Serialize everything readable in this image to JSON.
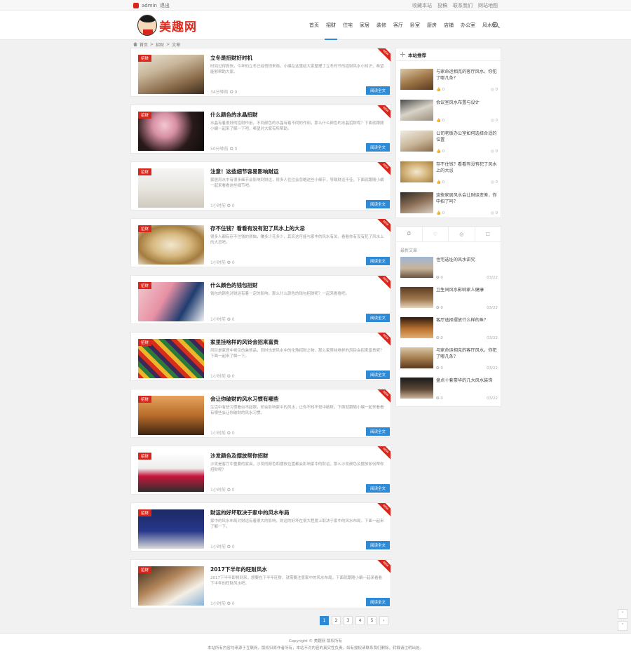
{
  "topbar": {
    "user": "admin",
    "exit": "退出",
    "right_links": [
      "收藏本站",
      "投稿",
      "联系我们",
      "网站地图"
    ]
  },
  "logo": {
    "text": "美趣网"
  },
  "nav": {
    "items": [
      "首页",
      "招财",
      "住宅",
      "家居",
      "装修",
      "客厅",
      "卧室",
      "厨房",
      "店铺",
      "办公室",
      "风水鱼"
    ],
    "active": 1
  },
  "breadcrumb": {
    "home": "首页",
    "sep": ">",
    "cat": "招财",
    "current": "文章"
  },
  "posts": [
    {
      "cat": "招财",
      "title": "立冬是招财好时机",
      "excerpt": "时间过得真快，今年的立冬已经悄悄来临，小编在这里给大家整理了立冬时节的招财风水小知识，希望能够帮助大家。",
      "time": "34分钟前",
      "comments": "0",
      "more": "阅读全文",
      "new": "NEW"
    },
    {
      "cat": "招财",
      "title": "什么颜色的水晶招财",
      "excerpt": "水晶有着很好的招财作用，不同颜色的水晶有着不同的作用，那么什么颜色的水晶招财呢？下面就跟随小编一起来了解一下吧，希望对大家有所帮助。",
      "time": "50分钟前",
      "comments": "0",
      "more": "阅读全文",
      "new": "NEW"
    },
    {
      "cat": "招财",
      "title": "注意！这些细节容易影响财运",
      "excerpt": "家居风水中有很多细节会影响到财运，很多人往往会忽略这些小细节，导致财运不佳，下面就跟随小编一起来看看这些细节吧。",
      "time": "1小时前",
      "comments": "0",
      "more": "阅读全文",
      "new": "NEW"
    },
    {
      "cat": "招财",
      "title": "存不住钱？看看有没有犯了风水上的大忌",
      "excerpt": "很多人都有存不住钱的烦恼，赚多少花多少，其实这可能与家中的风水有关，看看你有没有犯了风水上的大忌吧。",
      "time": "1小时前",
      "comments": "0",
      "more": "阅读全文",
      "new": "NEW"
    },
    {
      "cat": "招财",
      "title": "什么颜色的钱包招财",
      "excerpt": "钱包的颜色对财运有着一定的影响，那么什么颜色的钱包招财呢？一起来看看吧。",
      "time": "1小时前",
      "comments": "0",
      "more": "阅读全文",
      "new": "NEW"
    },
    {
      "cat": "招财",
      "title": "家里挂啥样的风铃会招来富贵",
      "excerpt": "风铃是家居中常见的装饰品，同时也是风水中的化煞招财之物，那么家里挂啥样的风铃会招来富贵呢？下面一起来了解一下。",
      "time": "1小时前",
      "comments": "0",
      "more": "阅读全文",
      "new": "NEW"
    },
    {
      "cat": "招财",
      "title": "会让你破财的风水习惯有哪些",
      "excerpt": "生活中有些习惯看似不起眼，却会影响家中的风水，让你不知不觉中破财，下面就跟随小编一起来看看有哪些会让你破财的风水习惯。",
      "time": "1小时前",
      "comments": "0",
      "more": "阅读全文",
      "new": "NEW"
    },
    {
      "cat": "招财",
      "title": "沙发颜色及摆放帮你招财",
      "excerpt": "沙发是客厅中重要的家具，沙发的颜色和摆放位置都会影响家中的财运，那么沙发颜色及摆放如何帮你招财呢？",
      "time": "1小时前",
      "comments": "0",
      "more": "阅读全文",
      "new": "NEW"
    },
    {
      "cat": "招财",
      "title": "财运的好坏取决于家中的风水布局",
      "excerpt": "家中的风水布局对财运有着很大的影响，财运的好坏在很大程度上取决于家中的风水布局，下面一起来了解一下。",
      "time": "1小时前",
      "comments": "0",
      "more": "阅读全文",
      "new": "NEW"
    },
    {
      "cat": "招财",
      "title": "2017下半年的旺财风水",
      "excerpt": "2017下半年即将到来，想要在下半年旺财，就需要注意家中的风水布局，下面就跟随小编一起来看看下半年的旺财风水吧。",
      "time": "1小时前",
      "comments": "0",
      "more": "阅读全文",
      "new": "NEW"
    }
  ],
  "sidebar": {
    "recommend_title": "本站推荐",
    "recommend": [
      {
        "title": "与家命运相克的客厅风水，你犯了哪几条？",
        "likes": "0",
        "views": "0"
      },
      {
        "title": "会议室风水布置与设计",
        "likes": "0",
        "views": "0"
      },
      {
        "title": "公司老板办公室如何选择合适的位置",
        "likes": "0",
        "views": "0"
      },
      {
        "title": "存不住钱？看看有没有犯了风水上的大忌",
        "likes": "0",
        "views": "0"
      },
      {
        "title": "这些家居风水会让财运变差，你中招了吗？",
        "likes": "0",
        "views": "0"
      }
    ],
    "tabs": [
      "⏱",
      "♡",
      "◎",
      "☐"
    ],
    "hot_label": "最新文章",
    "hot": [
      {
        "title": "住宅选址的风水讲究",
        "comments": "0",
        "date": "03/22"
      },
      {
        "title": "卫生间风水影响家人健康",
        "comments": "0",
        "date": "03/22"
      },
      {
        "title": "客厅选择摆放什么样的鱼？",
        "comments": "0",
        "date": "03/22"
      },
      {
        "title": "与家命运相克的客厅风水，你犯了哪几条？",
        "comments": "0",
        "date": "03/22"
      },
      {
        "title": "盘点十套豪华的几大风水装饰",
        "comments": "0",
        "date": "03/22"
      }
    ]
  },
  "pagination": {
    "pages": [
      "1",
      "2",
      "3",
      "4",
      "5",
      "›"
    ],
    "active": 0
  },
  "footer": {
    "line1": "Copyright © 美趣网 版权所有",
    "line2": "本站所有内容均来源于互联网，版权归原作者所有，本站不对内容的真实性负责，如有侵权请联系我们删除，转载请注明出处。"
  }
}
